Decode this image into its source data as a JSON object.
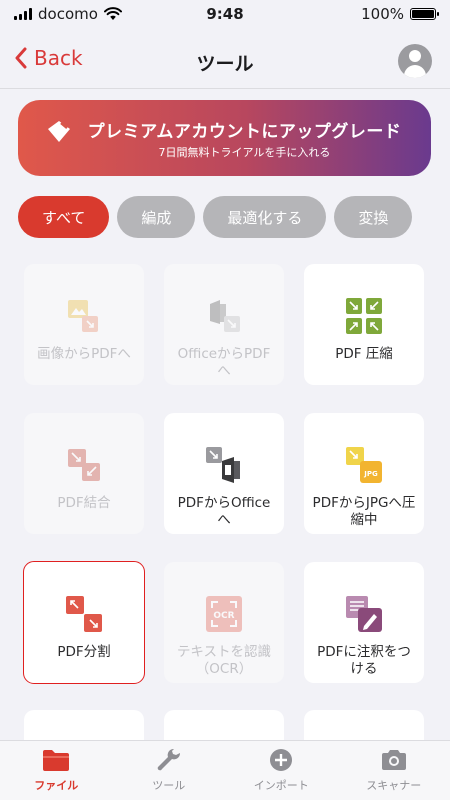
{
  "status_bar": {
    "carrier": "docomo",
    "time": "9:48",
    "battery": "100%",
    "battery_level": 1.0
  },
  "nav": {
    "back_label": "Back",
    "title": "ツール"
  },
  "premium": {
    "title": "プレミアムアカウントにアップグレード",
    "subtitle": "7日間無料トライアルを手に入れる"
  },
  "filters": [
    {
      "label": "すべて",
      "active": true
    },
    {
      "label": "編成",
      "active": false
    },
    {
      "label": "最適化する",
      "active": false
    },
    {
      "label": "変換",
      "active": false
    }
  ],
  "tools": [
    {
      "label": "画像からPDFへ",
      "icon": "image-to-pdf-icon",
      "enabled": false
    },
    {
      "label": "OfficeからPDFへ",
      "icon": "office-to-pdf-icon",
      "enabled": false
    },
    {
      "label": "PDF 圧縮",
      "icon": "compress-pdf-icon",
      "enabled": true
    },
    {
      "label": "PDF結合",
      "icon": "merge-pdf-icon",
      "enabled": false
    },
    {
      "label": "PDFからOfficeへ",
      "icon": "pdf-to-office-icon",
      "enabled": true
    },
    {
      "label": "PDFからJPGへ圧縮中",
      "icon": "pdf-to-jpg-icon",
      "enabled": true
    },
    {
      "label": "PDF分割",
      "icon": "split-pdf-icon",
      "enabled": true,
      "selected": true
    },
    {
      "label": "テキストを認識（OCR）",
      "icon": "ocr-icon",
      "enabled": false
    },
    {
      "label": "PDFに注釈をつける",
      "icon": "annotate-pdf-icon",
      "enabled": true
    }
  ],
  "colors": {
    "accent": "#d93a2e",
    "compress_green": "#7fa83a",
    "annotate_purple": "#8a4a7a"
  },
  "tabs": [
    {
      "label": "ファイル",
      "icon": "folder-icon",
      "active": true
    },
    {
      "label": "ツール",
      "icon": "wrench-icon",
      "active": false
    },
    {
      "label": "インポート",
      "icon": "plus-circle-icon",
      "active": false
    },
    {
      "label": "スキャナー",
      "icon": "camera-icon",
      "active": false
    }
  ]
}
